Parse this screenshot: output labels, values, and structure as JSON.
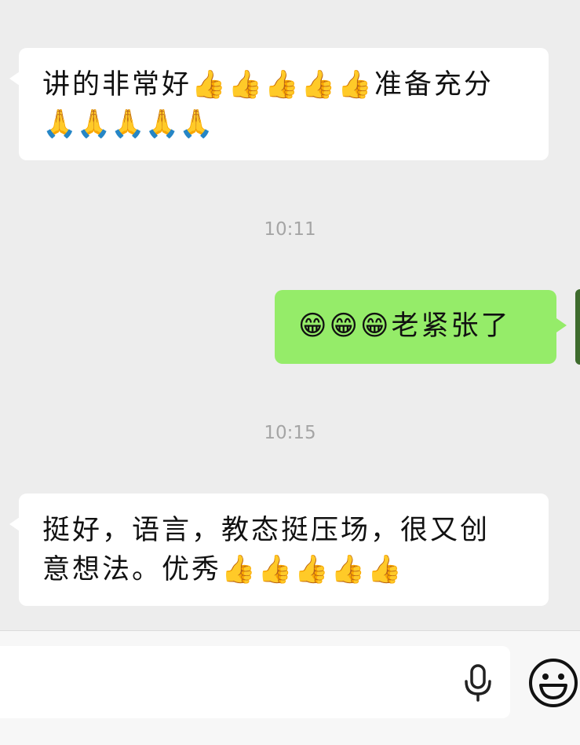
{
  "messages": [
    {
      "side": "received",
      "line1": "讲的非常好👍👍👍👍👍准备充分",
      "line2": "🙏🙏🙏🙏🙏"
    },
    {
      "time": "10:11"
    },
    {
      "side": "sent",
      "text": "😁😁😁老紧张了"
    },
    {
      "time": "10:15"
    },
    {
      "side": "received",
      "line1": "挺好，语言，教态挺压场，很又创",
      "line2": "意想法。优秀👍👍👍👍👍"
    }
  ],
  "input_bar": {
    "value": "",
    "icons": [
      "microphone-icon",
      "emoji-smile-icon"
    ]
  },
  "colors": {
    "background": "#ededed",
    "received_bubble": "#ffffff",
    "sent_bubble": "#95ec69",
    "timestamp": "#a5a5a5"
  }
}
